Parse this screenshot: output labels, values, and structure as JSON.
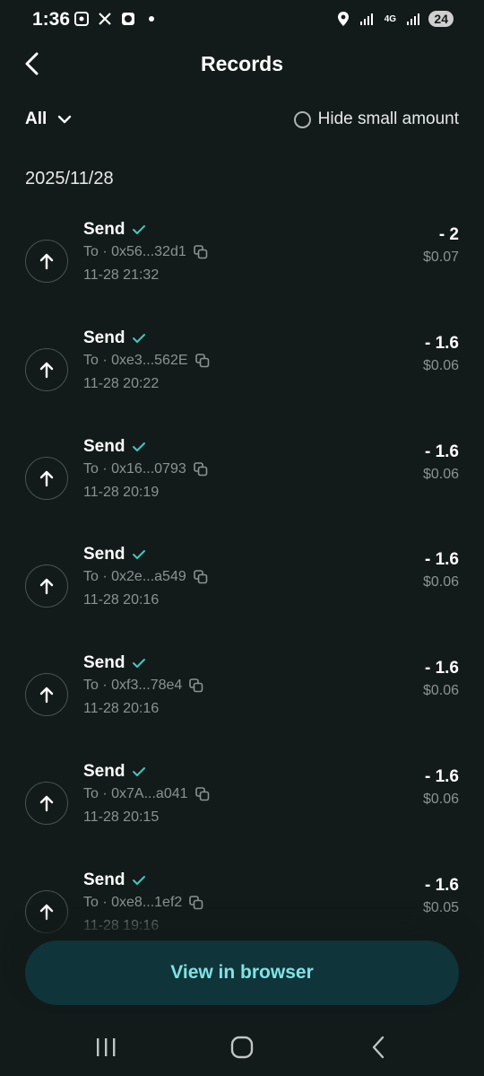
{
  "status_bar": {
    "time": "1:36",
    "battery": "24",
    "network": "4G"
  },
  "header": {
    "title": "Records"
  },
  "filter": {
    "label": "All",
    "hide_small_label": "Hide small amount"
  },
  "date_group": "2025/11/28",
  "records": [
    {
      "type": "Send",
      "to": "To · 0x56...32d1",
      "time": "11-28 21:32",
      "amount": "- 2",
      "usd": "$0.07"
    },
    {
      "type": "Send",
      "to": "To · 0xe3...562E",
      "time": "11-28 20:22",
      "amount": "- 1.6",
      "usd": "$0.06"
    },
    {
      "type": "Send",
      "to": "To · 0x16...0793",
      "time": "11-28 20:19",
      "amount": "- 1.6",
      "usd": "$0.06"
    },
    {
      "type": "Send",
      "to": "To · 0x2e...a549",
      "time": "11-28 20:16",
      "amount": "- 1.6",
      "usd": "$0.06"
    },
    {
      "type": "Send",
      "to": "To · 0xf3...78e4",
      "time": "11-28 20:16",
      "amount": "- 1.6",
      "usd": "$0.06"
    },
    {
      "type": "Send",
      "to": "To · 0x7A...a041",
      "time": "11-28 20:15",
      "amount": "- 1.6",
      "usd": "$0.06"
    },
    {
      "type": "Send",
      "to": "To · 0xe8...1ef2",
      "time": "11-28 19:16",
      "amount": "- 1.6",
      "usd": "$0.05"
    }
  ],
  "footer": {
    "view_browser_label": "View in browser"
  },
  "colors": {
    "background": "#131a1a",
    "accent": "#7fe3e6",
    "button_bg": "#0f3439",
    "check": "#3fc9c0",
    "muted": "#8a9292"
  }
}
